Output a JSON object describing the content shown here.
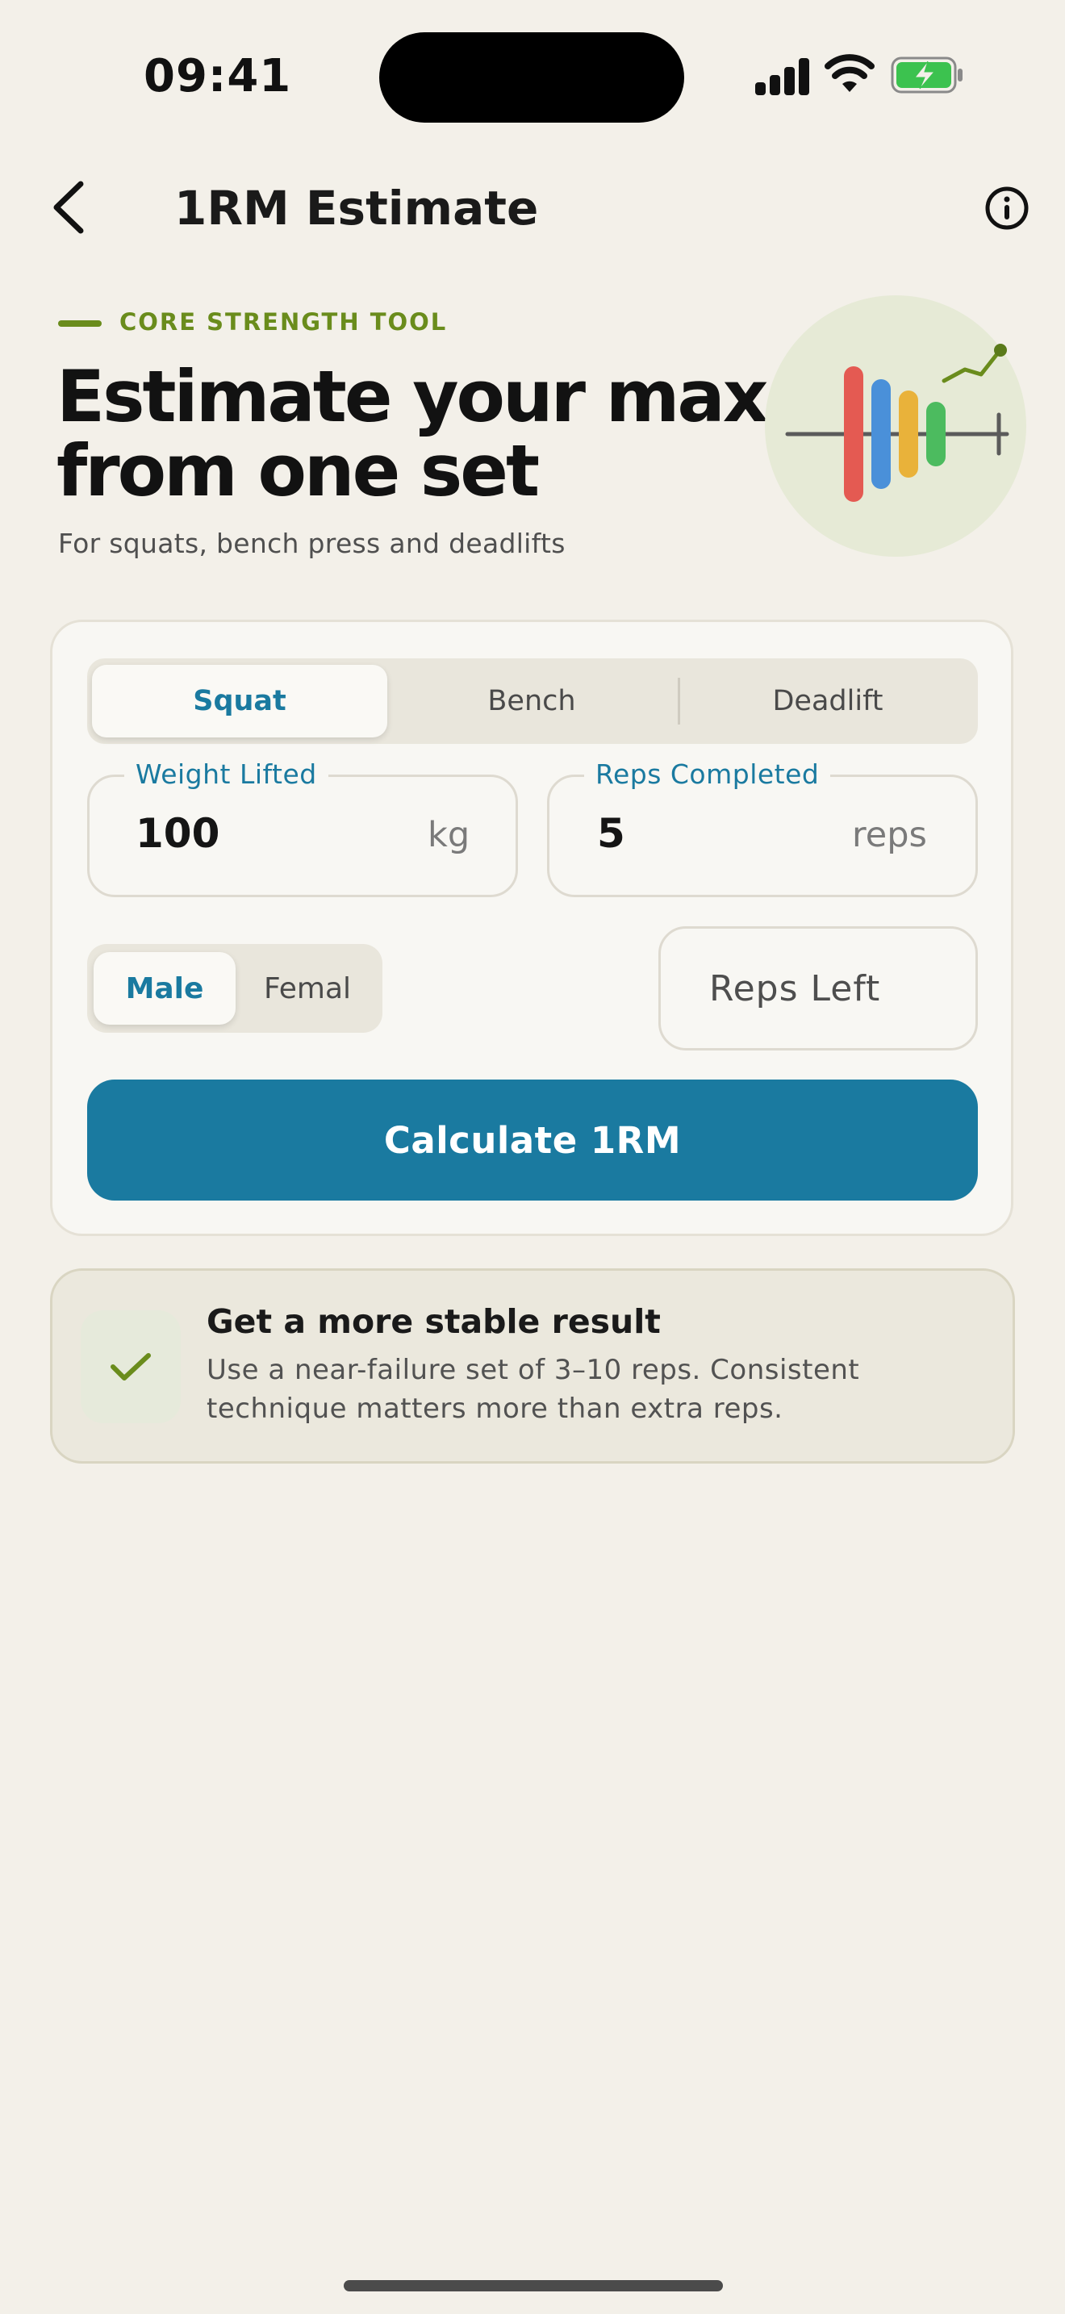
{
  "status_bar": {
    "time": "09:41"
  },
  "nav": {
    "title": "1RM Estimate"
  },
  "hero": {
    "eyebrow": "CORE STRENGTH TOOL",
    "headline_line1": "Estimate your max",
    "headline_line2": "from one set",
    "subhead": "For squats, bench press and deadlifts"
  },
  "lift_tabs": {
    "items": [
      "Squat",
      "Bench",
      "Deadlift"
    ],
    "selected": "Squat"
  },
  "weight_field": {
    "label": "Weight Lifted",
    "value": "100",
    "unit": "kg"
  },
  "reps_field": {
    "label": "Reps Completed",
    "value": "5",
    "unit": "reps"
  },
  "sex_toggle": {
    "items": [
      "Male",
      "Femal"
    ],
    "selected": "Male"
  },
  "reps_left": {
    "placeholder": "Reps Left"
  },
  "calculate_button": {
    "label": "Calculate 1RM"
  },
  "tip": {
    "title": "Get a more stable result",
    "body": "Use a near-failure set of 3–10 reps. Consistent technique matters more than extra reps."
  },
  "colors": {
    "accent": "#1a7aa0",
    "brand_green": "#6a8c1c",
    "background": "#f3f0e9",
    "illustration_bars": [
      "#e45a52",
      "#4a90d9",
      "#e9b23a",
      "#4cbb5f"
    ]
  },
  "icons": {
    "back": "chevron-left-icon",
    "info": "info-circle-icon",
    "tip": "checkmark-icon",
    "illustration": "barbell-chart-illustration"
  }
}
